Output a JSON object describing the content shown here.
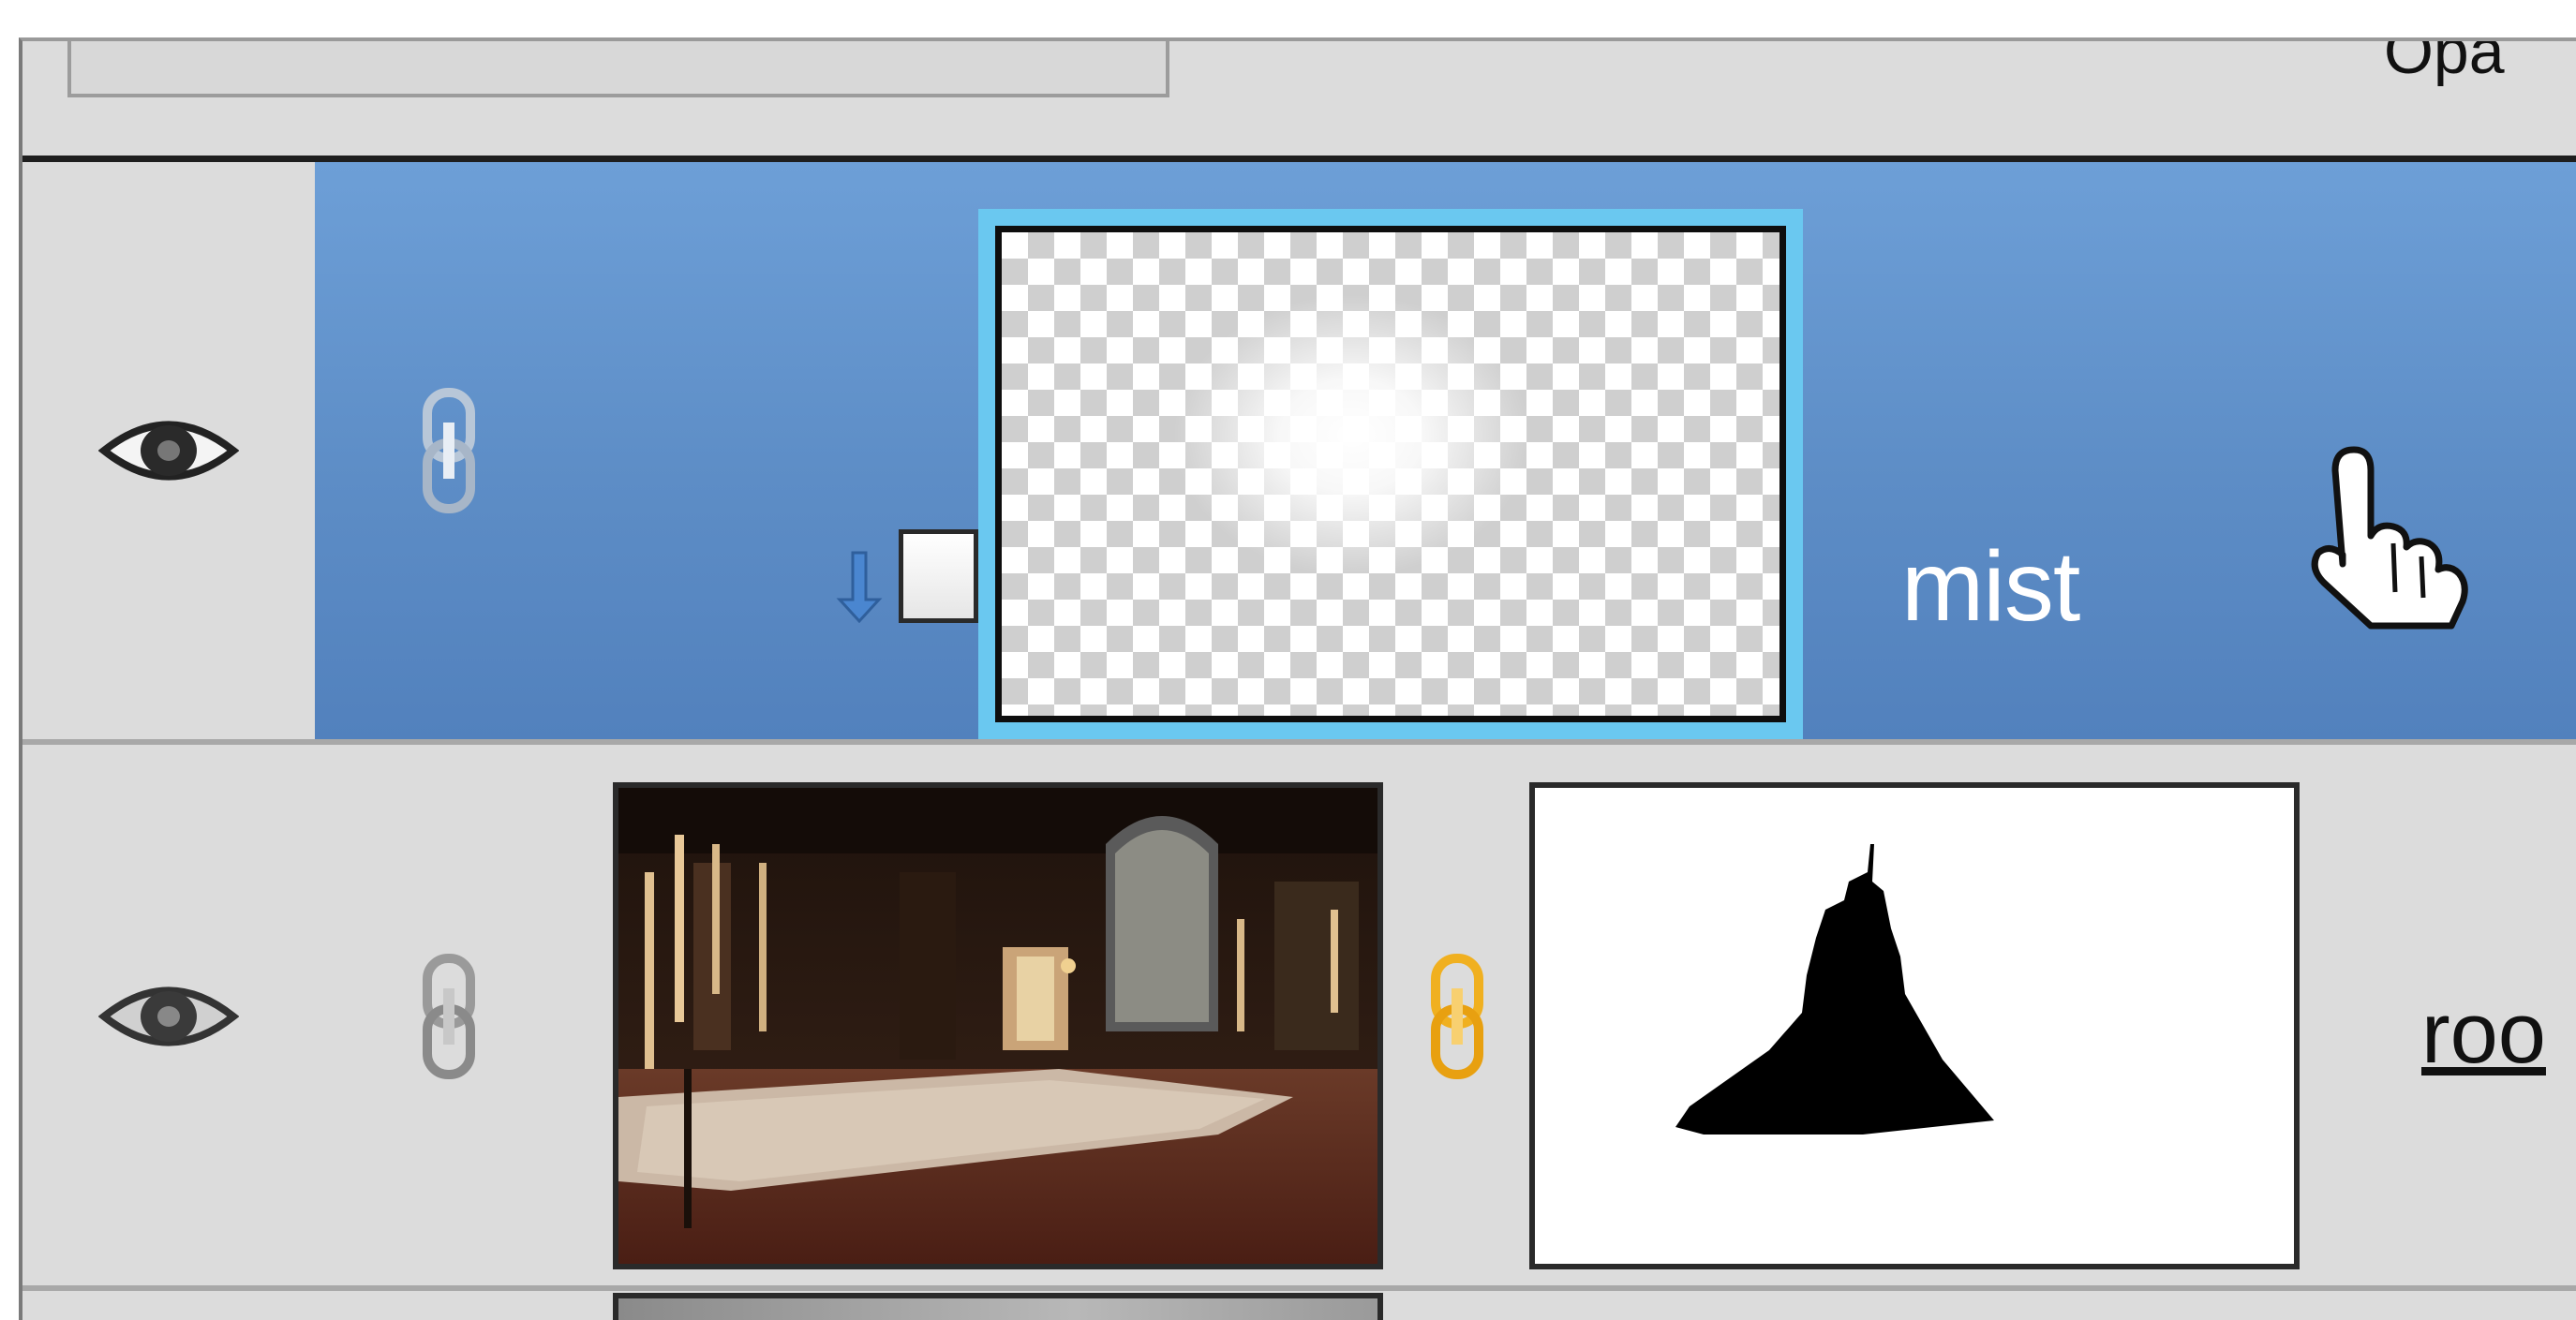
{
  "top_strip": {
    "blend_mode_value": "",
    "opacity_label": "Opa"
  },
  "layers": [
    {
      "name": "mist",
      "selected": true,
      "visible": true,
      "thumbnail": "transparent-with-white-glow",
      "clipped_indicator": true
    },
    {
      "name": "roo",
      "selected": false,
      "visible": true,
      "thumbnail": "ballroom-photo",
      "mask": "dress-silhouette",
      "mask_linked": true
    },
    {
      "name": "",
      "partial": true
    }
  ],
  "colors": {
    "selection_blue": "#6d9fd7",
    "thumb_highlight": "#6ac8f0",
    "link_active": "#f0a820",
    "panel_bg": "#dcdcdc"
  },
  "icons": [
    "eye-icon",
    "chain-link-icon",
    "clip-arrow-icon",
    "hand-cursor-icon"
  ]
}
